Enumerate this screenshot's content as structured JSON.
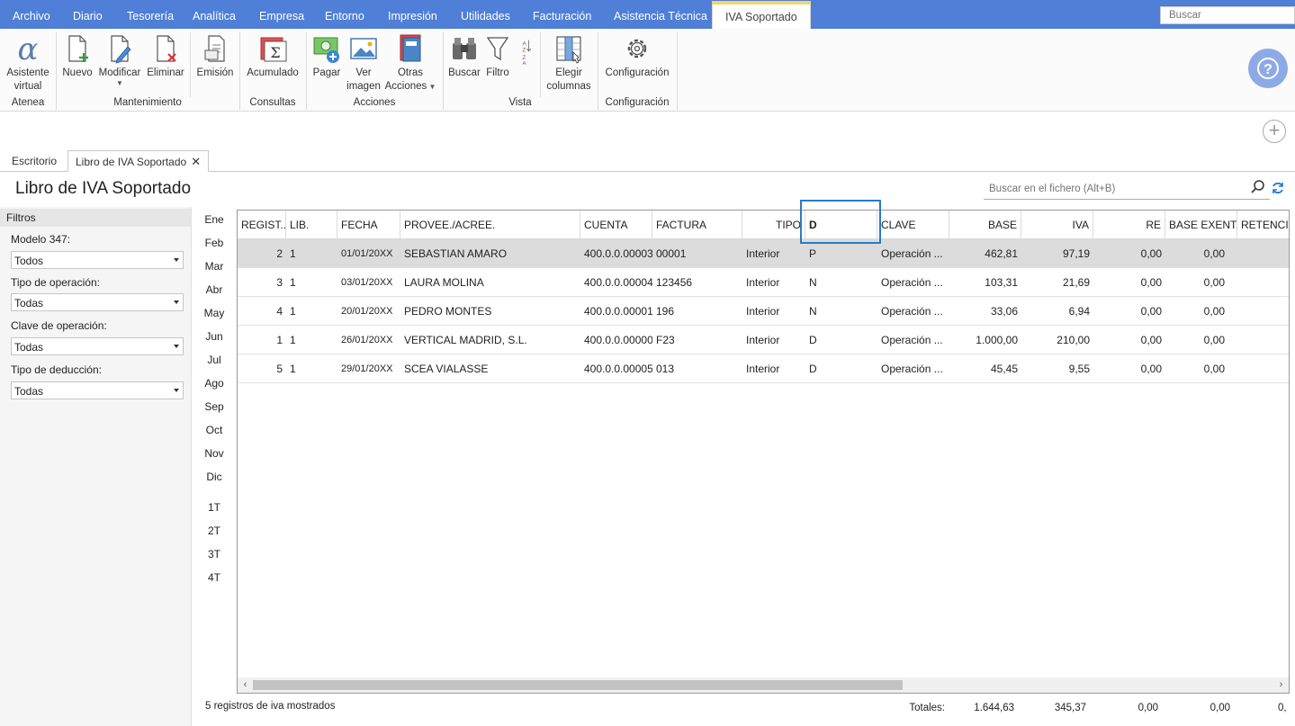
{
  "menu": {
    "items": [
      "Archivo",
      "Diario",
      "Tesorería",
      "Analítica",
      "Empresa",
      "Entorno",
      "Impresión",
      "Utilidades",
      "Facturación",
      "Asistencia Técnica"
    ],
    "active": "IVA Soportado",
    "search_placeholder": "Buscar"
  },
  "ribbon": {
    "assistant": "Asistente virtual",
    "new": "Nuevo",
    "modify": "Modificar",
    "delete": "Eliminar",
    "emission": "Emisión",
    "accumulated": "Acumulado",
    "pay": "Pagar",
    "view_image": "Ver imagen",
    "other_actions": "Otras Acciones",
    "search": "Buscar",
    "filter": "Filtro",
    "choose_columns": "Elegir columnas",
    "configuration": "Configuración",
    "groups": {
      "atenea": "Atenea",
      "maintenance": "Mantenimiento",
      "queries": "Consultas",
      "actions": "Acciones",
      "view": "Vista",
      "configuration": "Configuración"
    }
  },
  "tabs": [
    "Escritorio",
    "Libro de IVA Soportado"
  ],
  "page_title": "Libro de IVA Soportado",
  "file_search_placeholder": "Buscar en el fichero (Alt+B)",
  "filters": {
    "title": "Filtros",
    "model_347_label": "Modelo 347:",
    "model_347_value": "Todos",
    "operation_type_label": "Tipo de operación:",
    "operation_type_value": "Todas",
    "operation_key_label": "Clave de operación:",
    "operation_key_value": "Todas",
    "deduction_type_label": "Tipo de deducción:",
    "deduction_type_value": "Todas"
  },
  "months": [
    "Ene",
    "Feb",
    "Mar",
    "Abr",
    "May",
    "Jun",
    "Jul",
    "Ago",
    "Sep",
    "Oct",
    "Nov",
    "Dic"
  ],
  "quarters": [
    "1T",
    "2T",
    "3T",
    "4T"
  ],
  "table": {
    "headers": {
      "regist": "REGIST...",
      "lib": "LIB.",
      "fecha": "FECHA",
      "proveedor": "PROVEE./ACREE.",
      "cuenta": "CUENTA",
      "factura": "FACTURA",
      "tipo": "TIPO",
      "d": "D",
      "clave": "CLAVE",
      "base": "BASE",
      "iva": "IVA",
      "re": "RE",
      "base_exenta": "BASE EXENTA",
      "retencion": "RETENCI"
    },
    "rows": [
      {
        "regist": "2",
        "lib": "1",
        "fecha": "01/01/20XX",
        "proveedor": "SEBASTIAN AMARO",
        "cuenta": "400.0.0.00003",
        "factura": "00001",
        "tipo": "Interior",
        "d": "P",
        "clave": "Operación ...",
        "base": "462,81",
        "iva": "97,19",
        "re": "0,00",
        "base_exenta": "0,00"
      },
      {
        "regist": "3",
        "lib": "1",
        "fecha": "03/01/20XX",
        "proveedor": "LAURA MOLINA",
        "cuenta": "400.0.0.00004",
        "factura": "123456",
        "tipo": "Interior",
        "d": "N",
        "clave": "Operación ...",
        "base": "103,31",
        "iva": "21,69",
        "re": "0,00",
        "base_exenta": "0,00"
      },
      {
        "regist": "4",
        "lib": "1",
        "fecha": "20/01/20XX",
        "proveedor": "PEDRO MONTES",
        "cuenta": "400.0.0.00001",
        "factura": "196",
        "tipo": "Interior",
        "d": "N",
        "clave": "Operación ...",
        "base": "33,06",
        "iva": "6,94",
        "re": "0,00",
        "base_exenta": "0,00"
      },
      {
        "regist": "1",
        "lib": "1",
        "fecha": "26/01/20XX",
        "proveedor": "VERTICAL MADRID, S.L.",
        "cuenta": "400.0.0.00000",
        "factura": "F23",
        "tipo": "Interior",
        "d": "D",
        "clave": "Operación ...",
        "base": "1.000,00",
        "iva": "210,00",
        "re": "0,00",
        "base_exenta": "0,00"
      },
      {
        "regist": "5",
        "lib": "1",
        "fecha": "29/01/20XX",
        "proveedor": "SCEA VIALASSE",
        "cuenta": "400.0.0.00005",
        "factura": "013",
        "tipo": "Interior",
        "d": "D",
        "clave": "Operación ...",
        "base": "45,45",
        "iva": "9,55",
        "re": "0,00",
        "base_exenta": "0,00"
      }
    ]
  },
  "status": "5 registros de iva mostrados",
  "totals": {
    "label": "Totales:",
    "base": "1.644,63",
    "iva": "345,37",
    "re": "0,00",
    "base_exenta": "0,00",
    "retencion": "0,"
  },
  "colors": {
    "menubar": "#4f7fd6",
    "active_tab_accent": "#f4d36b",
    "selected_row": "#dcdcdc",
    "highlight_box": "#2a7bc5"
  }
}
